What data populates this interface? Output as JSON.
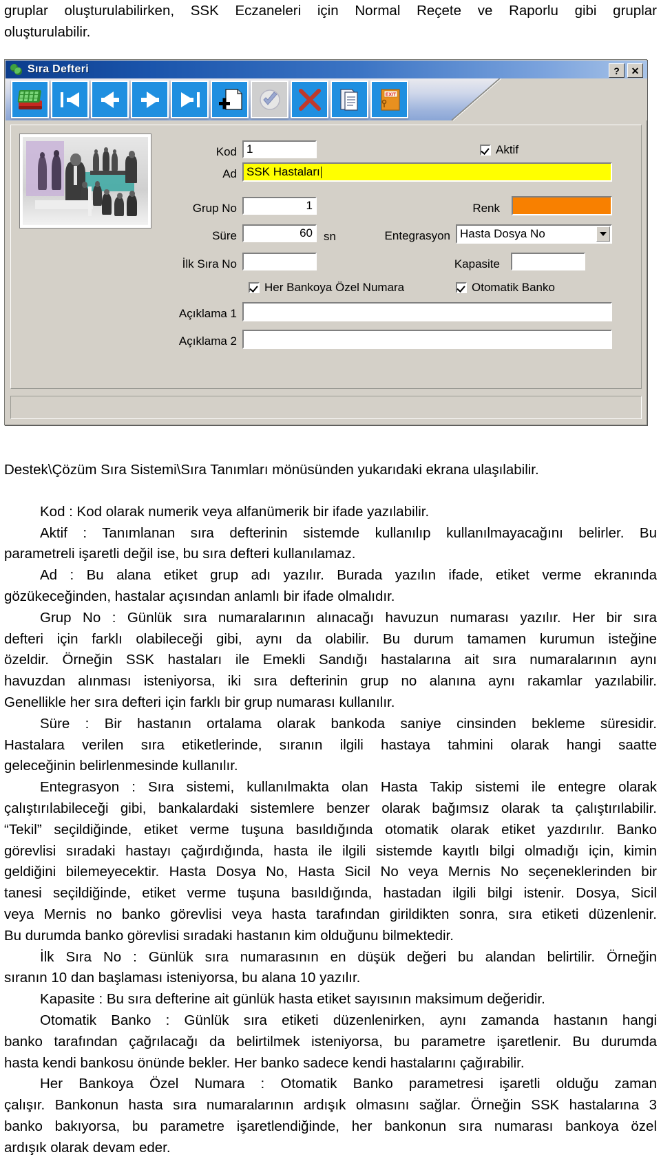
{
  "top_paragraph": {
    "line1": "gruplar oluşturulabilirken, SSK Eczaneleri için Normal Reçete ve Raporlu gibi gruplar",
    "line2": "oluşturulabilir."
  },
  "dialog": {
    "title": "Sıra Defteri",
    "title_icon": "recycle-icon",
    "window_buttons": [
      {
        "name": "help-button",
        "label": "?"
      },
      {
        "name": "close-button",
        "label": "✕"
      }
    ],
    "toolbar": [
      {
        "name": "cash-register-button",
        "icon": "cash-register-icon",
        "enabled": true
      },
      {
        "name": "first-record-button",
        "icon": "first-record-icon",
        "enabled": true
      },
      {
        "name": "previous-record-button",
        "icon": "previous-record-icon",
        "enabled": true
      },
      {
        "name": "next-record-button",
        "icon": "next-record-icon",
        "enabled": true
      },
      {
        "name": "last-record-button",
        "icon": "last-record-icon",
        "enabled": true
      },
      {
        "name": "new-record-button",
        "icon": "new-document-plus-icon",
        "enabled": true
      },
      {
        "name": "confirm-button",
        "icon": "check-shield-icon",
        "enabled": false
      },
      {
        "name": "delete-button",
        "icon": "red-x-icon",
        "enabled": true
      },
      {
        "name": "report-button",
        "icon": "document-report-icon",
        "enabled": true
      },
      {
        "name": "exit-button",
        "icon": "exit-door-icon",
        "enabled": true
      }
    ],
    "preview_image": "office-people-collage",
    "fields": {
      "kod": {
        "label": "Kod",
        "value": "1"
      },
      "ad": {
        "label": "Ad",
        "value": "SSK Hastaları",
        "highlight_color": "#ffff00"
      },
      "grup_no": {
        "label": "Grup No",
        "value": "1"
      },
      "sure": {
        "label": "Süre",
        "value": "60",
        "unit": "sn"
      },
      "ilk_sira_no": {
        "label": "İlk Sıra No",
        "value": ""
      },
      "aciklama_1": {
        "label": "Açıklama 1",
        "value": ""
      },
      "aciklama_2": {
        "label": "Açıklama 2",
        "value": ""
      },
      "aktif": {
        "label": "Aktif",
        "checked": true
      },
      "renk": {
        "label": "Renk",
        "color": "#f88000"
      },
      "entegrasyon": {
        "label": "Entegrasyon",
        "value": "Hasta Dosya No"
      },
      "kapasite": {
        "label": "Kapasite",
        "value": ""
      },
      "her_bankoya_ozel_numara": {
        "label": "Her Bankoya Özel Numara",
        "checked": true
      },
      "otomatik_banko": {
        "label": "Otomatik Banko",
        "checked": true
      }
    }
  },
  "body": {
    "l01": "Destek\\Çözüm Sıra Sistemi\\Sıra Tanımları mönüsünden yukarıdaki ekrana ulaşılabilir.",
    "l02": "Kod :  Kod olarak numerik veya alfanümerik bir ifade yazılabilir.",
    "l03": "Aktif : Tanımlanan sıra defterinin sistemde kullanılıp kullanılmayacağını belirler. Bu",
    "l04": "parametreli işaretli değil ise, bu sıra defteri kullanılamaz.",
    "l05": "Ad : Bu alana etiket grup adı yazılır. Burada yazılın ifade, etiket verme ekranında",
    "l06": "gözükeceğinden, hastalar açısından anlamlı bir ifade olmalıdır.",
    "l07": "Grup No : Günlük sıra numaralarının alınacağı havuzun numarası yazılır. Her bir sıra",
    "l08": "defteri için farklı olabileceği gibi, aynı da olabilir. Bu durum tamamen kurumun isteğine",
    "l09": "özeldir. Örneğin SSK hastaları ile Emekli Sandığı hastalarına ait sıra numaralarının aynı",
    "l10": "havuzdan alınması isteniyorsa, iki sıra defterinin grup no alanına aynı rakamlar yazılabilir.",
    "l11": "Genellikle her sıra defteri için farklı bir grup numarası kullanılır.",
    "l12": "Süre : Bir hastanın ortalama olarak bankoda saniye cinsinden bekleme süresidir.",
    "l13": "Hastalara verilen sıra etiketlerinde, sıranın ilgili hastaya tahmini olarak hangi saatte",
    "l14": "geleceğinin belirlenmesinde kullanılır.",
    "l15": "Entegrasyon : Sıra sistemi, kullanılmakta olan Hasta Takip sistemi ile entegre olarak",
    "l16": "çalıştırılabileceği gibi, bankalardaki sistemlere benzer olarak bağımsız olarak ta çalıştırılabilir.",
    "l17": "“Tekil” seçildiğinde, etiket verme tuşuna basıldığında otomatik olarak etiket yazdırılır. Banko",
    "l18": "görevlisi sıradaki hastayı çağırdığında, hasta ile ilgili sistemde kayıtlı bilgi olmadığı için, kimin",
    "l19": "geldiğini bilemeyecektir. Hasta Dosya No, Hasta Sicil No veya Mernis No seçeneklerinden bir",
    "l20": "tanesi seçildiğinde, etiket verme tuşuna basıldığında, hastadan ilgili bilgi istenir. Dosya, Sicil",
    "l21": "veya Mernis no banko görevlisi veya hasta tarafından girildikten sonra, sıra etiketi düzenlenir.",
    "l22": "Bu durumda banko görevlisi sıradaki hastanın kim olduğunu bilmektedir.",
    "l23": "İlk Sıra No : Günlük sıra numarasının en düşük değeri bu alandan belirtilir. Örneğin",
    "l24": "sıranın 10 dan başlaması isteniyorsa, bu alana 10 yazılır.",
    "l25": "Kapasite : Bu sıra defterine ait günlük hasta etiket sayısının maksimum değeridir.",
    "l26": "Otomatik Banko : Günlük sıra etiketi düzenlenirken, aynı zamanda hastanın hangi",
    "l27": "banko tarafından çağrılacağı da belirtilmek isteniyorsa, bu parametre işaretlenir. Bu durumda",
    "l28": "hasta kendi bankosu önünde bekler. Her banko sadece kendi hastalarını çağırabilir.",
    "l29": "Her Bankoya Özel Numara : Otomatik Banko parametresi işaretli olduğu zaman",
    "l30": "çalışır. Bankonun hasta sıra numaralarının ardışık olmasını sağlar. Örneğin SSK hastalarına 3",
    "l31": "banko bakıyorsa, bu parametre işaretlendiğinde, her bankonun sıra numarası bankoya özel",
    "l32": "ardışık olarak devam eder."
  }
}
